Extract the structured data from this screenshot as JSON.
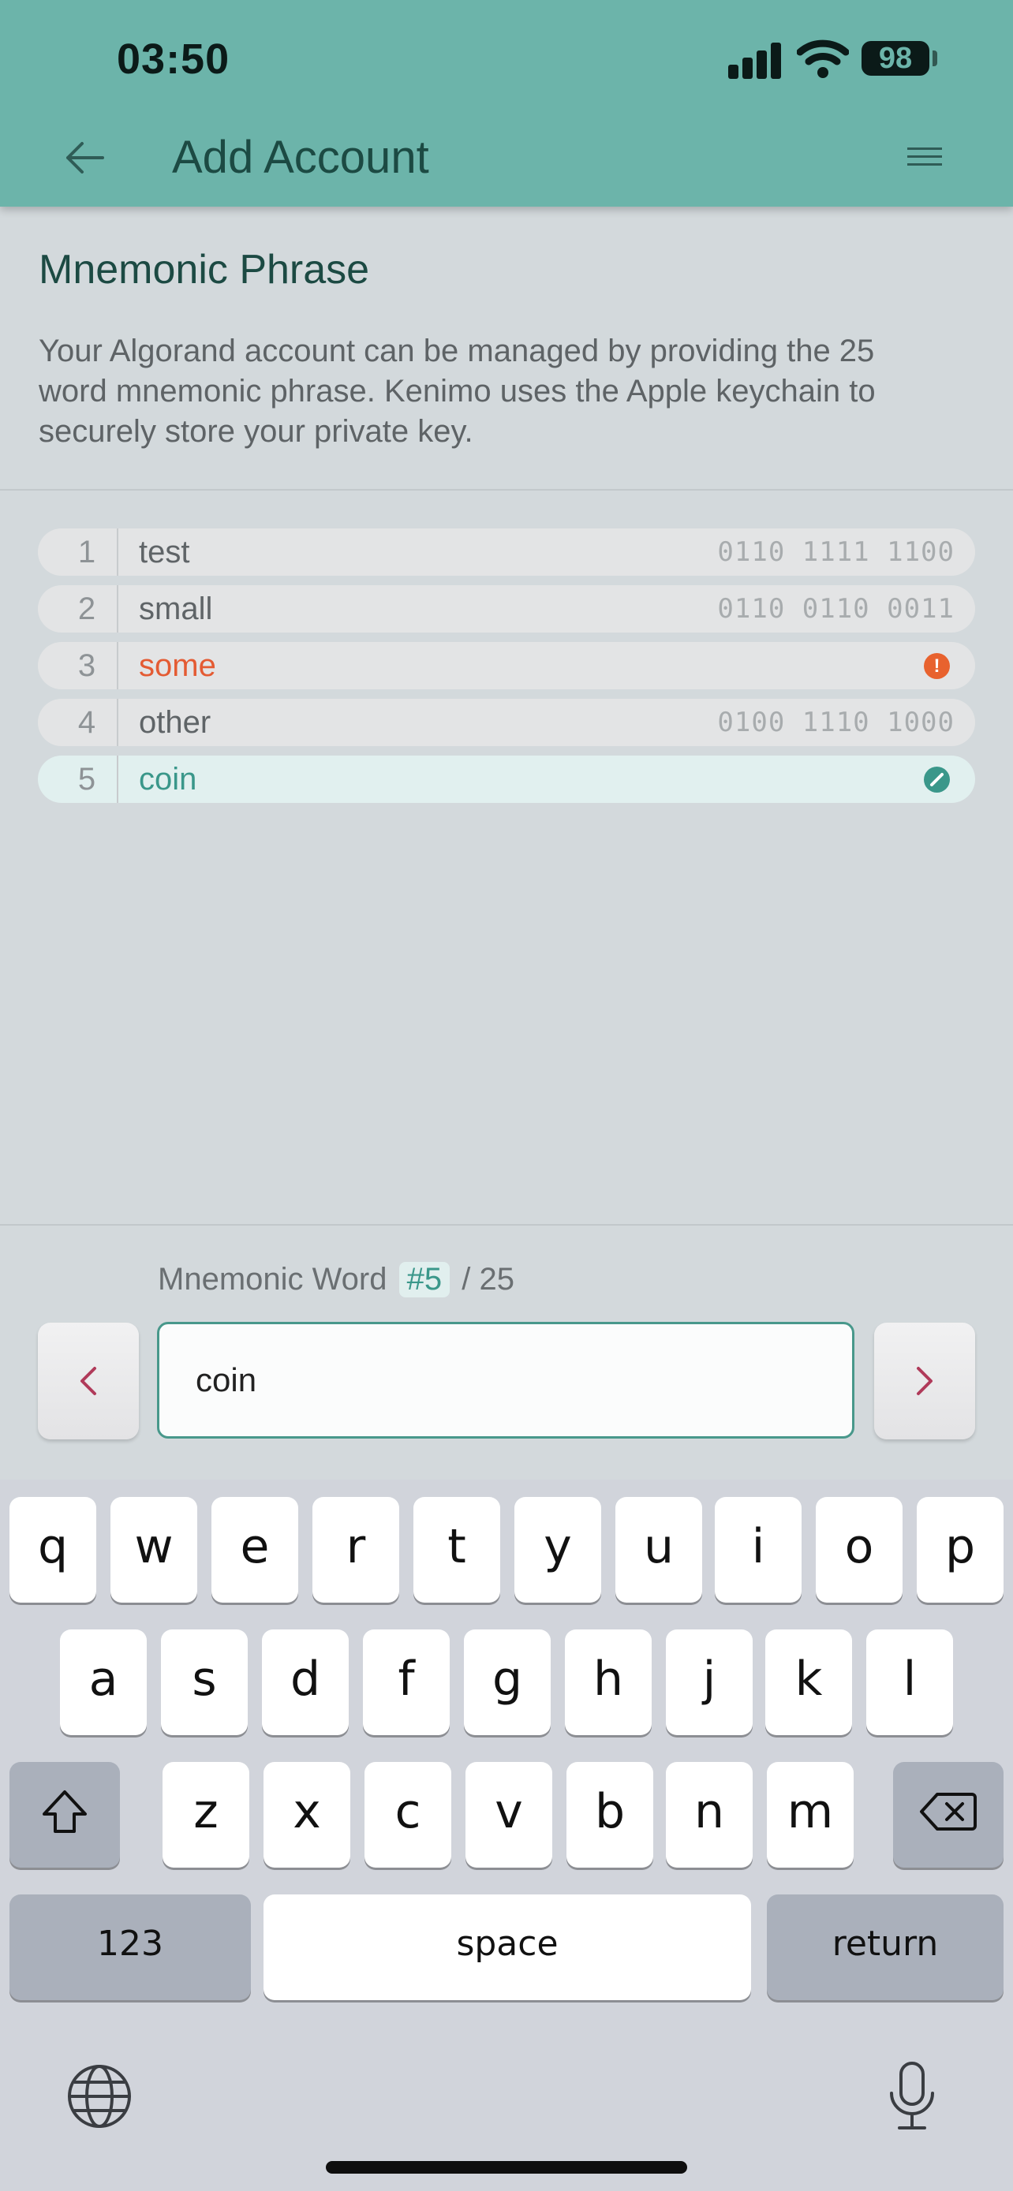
{
  "status_bar": {
    "time": "03:50",
    "battery": "98"
  },
  "header": {
    "title": "Add Account"
  },
  "section": {
    "title": "Mnemonic Phrase",
    "description_lines": [
      "Your Algorand account can be managed by providing the 25",
      "word mnemonic phrase. Kenimo uses the Apple keychain to",
      "securely store your private key."
    ]
  },
  "words": [
    {
      "num": "1",
      "word": "test",
      "bits": "0110 1111 1100",
      "state": "valid"
    },
    {
      "num": "2",
      "word": "small",
      "bits": "0110 0110 0011",
      "state": "valid"
    },
    {
      "num": "3",
      "word": "some",
      "bits": "",
      "state": "error",
      "icon": "exclamation-icon"
    },
    {
      "num": "4",
      "word": "other",
      "bits": "0100 1110 1000",
      "state": "valid"
    },
    {
      "num": "5",
      "word": "coin",
      "bits": "",
      "state": "active",
      "icon": "pencil-icon"
    }
  ],
  "input": {
    "label": "Mnemonic Word",
    "current": "#5",
    "total": "/ 25",
    "value": "coin"
  },
  "keyboard": {
    "row1": [
      "q",
      "w",
      "e",
      "r",
      "t",
      "y",
      "u",
      "i",
      "o",
      "p"
    ],
    "row2": [
      "a",
      "s",
      "d",
      "f",
      "g",
      "h",
      "j",
      "k",
      "l"
    ],
    "row3": [
      "z",
      "x",
      "c",
      "v",
      "b",
      "n",
      "m"
    ],
    "numbers_label": "123",
    "space_label": "space",
    "return_label": "return"
  },
  "colors": {
    "header": "#6cb4aa",
    "accent": "#3a978a",
    "error": "#e45b33",
    "nav_arrow": "#b03a5a"
  }
}
